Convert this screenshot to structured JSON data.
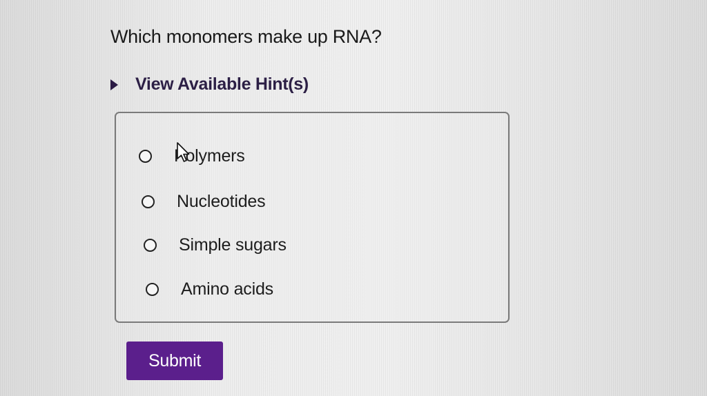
{
  "question": {
    "text": "Which monomers make up RNA?"
  },
  "hint": {
    "label": "View Available Hint(s)",
    "icon": "triangle-right-icon"
  },
  "options": [
    {
      "label": "Polymers",
      "selected": false
    },
    {
      "label": "Nucleotides",
      "selected": false
    },
    {
      "label": "Simple sugars",
      "selected": false
    },
    {
      "label": "Amino acids",
      "selected": false
    }
  ],
  "submit": {
    "label": "Submit"
  },
  "colors": {
    "submit_bg": "#5b1f8c",
    "hint_text": "#2c1f45",
    "background": "#e9e9e9"
  },
  "pointer": {
    "icon": "mouse-pointer-icon"
  }
}
